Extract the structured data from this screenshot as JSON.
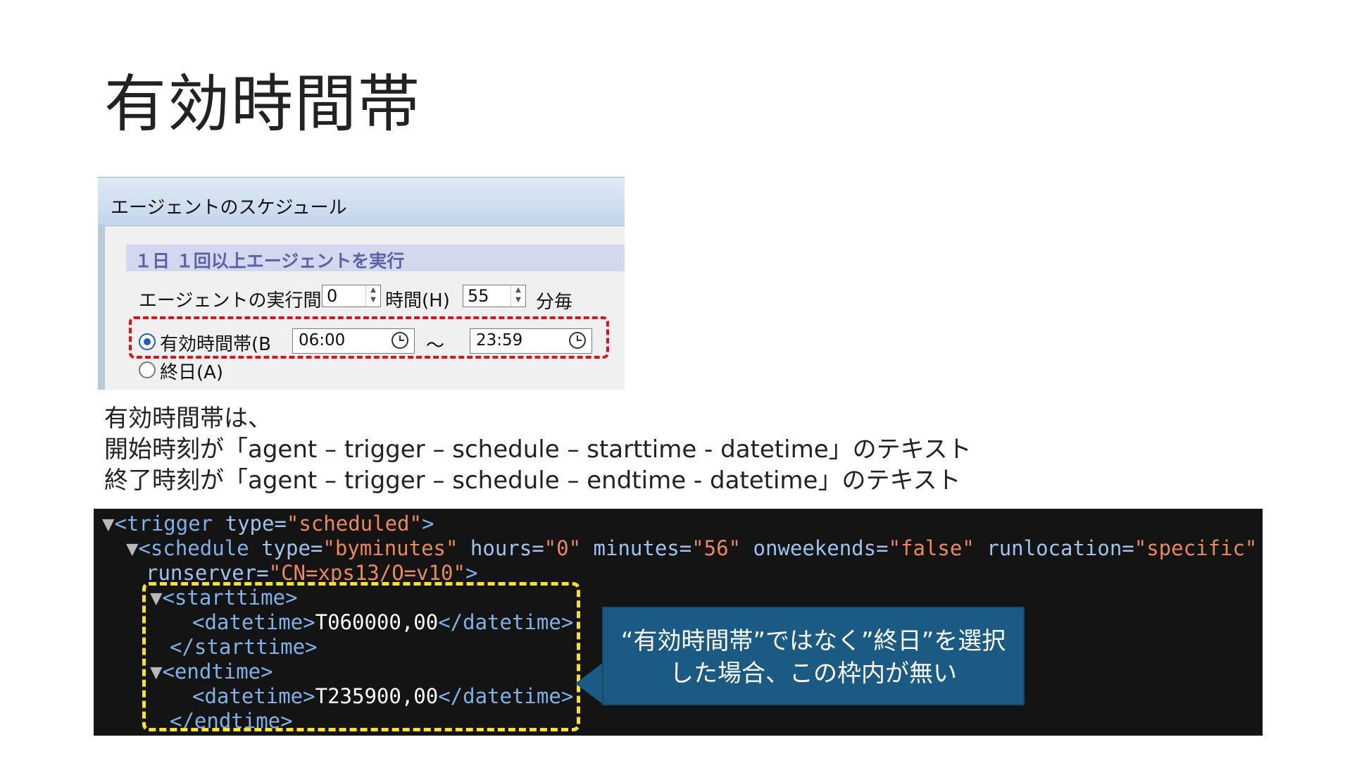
{
  "slide": {
    "title": "有効時間帯"
  },
  "dialog": {
    "header": "エージェントのスケジュール",
    "section": "１日 １回以上エージェントを実行",
    "interval_label": "エージェントの実行間",
    "hours_value": "0",
    "hours_unit": "時間(H)",
    "minutes_value": "55",
    "minutes_unit": "分毎",
    "valid_period_label": "有効時間帯(B",
    "start_time": "06:00",
    "tilde": "～",
    "end_time": "23:59",
    "all_day_label": "終日(A)"
  },
  "description": {
    "line1": "有効時間帯は、",
    "line2": "開始時刻が「agent – trigger – schedule – starttime - datetime」のテキスト",
    "line3": "終了時刻が「agent – trigger – schedule – endtime - datetime」のテキスト"
  },
  "code": {
    "l1_tri": "▼",
    "l1_open": "<trigger ",
    "l1_attr": "type=",
    "l1_val": "\"scheduled\"",
    "l1_close": ">",
    "l2_tri": "▼",
    "l2_open": "<schedule ",
    "l2_a1": "type=",
    "l2_v1": "\"byminutes\"",
    "l2_a2": " hours=",
    "l2_v2": "\"0\"",
    "l2_a3": " minutes=",
    "l2_v3": "\"56\"",
    "l2_a4": " onweekends=",
    "l2_v4": "\"false\"",
    "l2_a5": " runlocation=",
    "l2_v5": "\"specific\"",
    "l3_a": "runserver=",
    "l3_v": "\"CN=xps13/O=v10\"",
    "l3_close": ">",
    "l4_tri": "▼",
    "l4_tag": "<starttime>",
    "l5_open": "<datetime>",
    "l5_text": "T060000,00",
    "l5_close": "</datetime>",
    "l6_tag": "</starttime>",
    "l7_tri": "▼",
    "l7_tag": "<endtime>",
    "l8_open": "<datetime>",
    "l8_text": "T235900,00",
    "l8_close": "</datetime>",
    "l9_tag": "</endtime>"
  },
  "callout": {
    "line1": "“有効時間帯”ではなく”終日”を選択",
    "line2": "した場合、この枠内が無い"
  },
  "colors": {
    "red_highlight": "#e3101a",
    "yellow_highlight": "#f7e12a",
    "callout_bg": "#1b5a82",
    "code_bg": "#141414"
  }
}
